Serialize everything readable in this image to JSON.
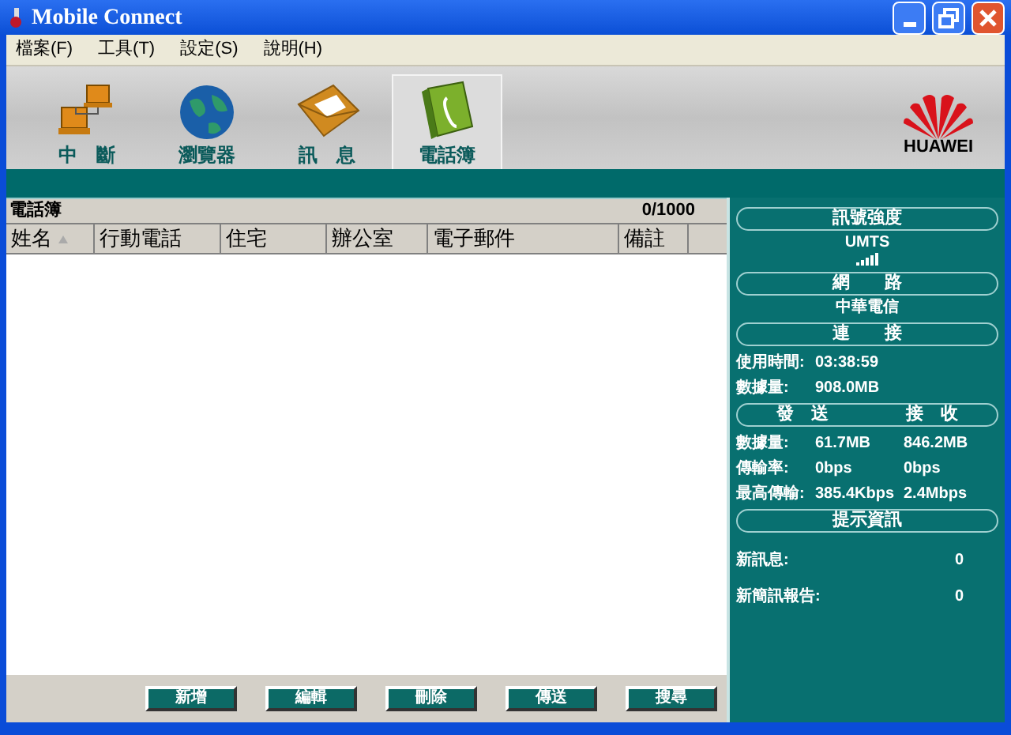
{
  "window": {
    "title": "Mobile Connect"
  },
  "menu": [
    "檔案(F)",
    "工具(T)",
    "設定(S)",
    "說明(H)"
  ],
  "toolbar": [
    {
      "kind": "disconnect",
      "label": "中　斷",
      "selected": false
    },
    {
      "kind": "browser",
      "label": "瀏覽器",
      "selected": false
    },
    {
      "kind": "message",
      "label": "訊　息",
      "selected": false
    },
    {
      "kind": "phonebook",
      "label": "電話簿",
      "selected": true
    }
  ],
  "brand": "HUAWEI",
  "phonebook": {
    "title": "電話簿",
    "count": "0/1000",
    "columns": [
      {
        "label": "姓名",
        "sorted": true
      },
      {
        "label": "行動電話",
        "sorted": false
      },
      {
        "label": "住宅",
        "sorted": false
      },
      {
        "label": "辦公室",
        "sorted": false
      },
      {
        "label": "電子郵件",
        "sorted": false
      },
      {
        "label": "備註",
        "sorted": false
      }
    ],
    "buttons": [
      "新增",
      "編輯",
      "刪除",
      "傳送",
      "搜尋"
    ]
  },
  "status_panel": [
    {
      "kind": "header",
      "labels": [
        "訊號強度"
      ]
    },
    {
      "kind": "center",
      "text": "UMTS"
    },
    {
      "kind": "signal"
    },
    {
      "kind": "header",
      "labels": [
        "網　　路"
      ]
    },
    {
      "kind": "center",
      "text": "中華電信"
    },
    {
      "kind": "header",
      "labels": [
        "連　　接"
      ]
    },
    {
      "kind": "field",
      "label": "使用時間:",
      "values": [
        "03:38:59"
      ]
    },
    {
      "kind": "field",
      "label": "數據量:",
      "values": [
        "908.0MB"
      ]
    },
    {
      "kind": "header",
      "labels": [
        "發　送",
        "接　收"
      ]
    },
    {
      "kind": "field",
      "label": "數據量:",
      "values": [
        "61.7MB",
        "846.2MB"
      ]
    },
    {
      "kind": "field",
      "label": "傳輸率:",
      "values": [
        "0bps",
        "0bps"
      ]
    },
    {
      "kind": "field",
      "label": "最高傳輸:",
      "values": [
        "385.4Kbps",
        "2.4Mbps"
      ]
    },
    {
      "kind": "header",
      "labels": [
        "提示資訊"
      ]
    },
    {
      "kind": "count",
      "label": "新訊息:",
      "value": "0"
    },
    {
      "kind": "count",
      "label": "新簡訊報告:",
      "value": "0"
    }
  ]
}
